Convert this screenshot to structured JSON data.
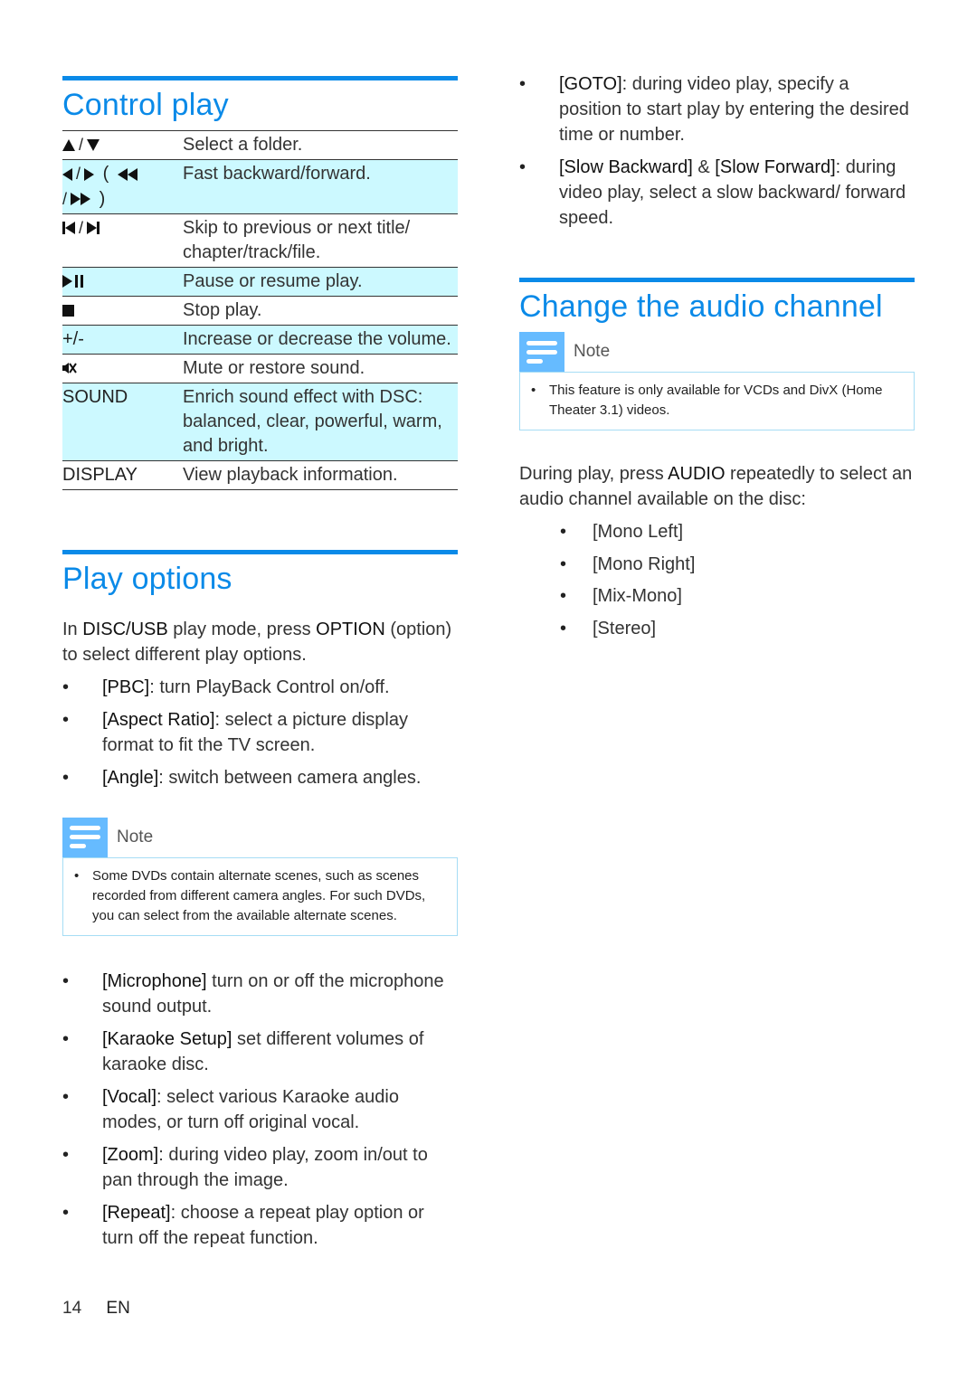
{
  "control_play": {
    "title": "Control play",
    "rows": [
      {
        "key_icons": [
          "up-triangle",
          "down-triangle"
        ],
        "desc": "Select a folder.",
        "highlight": false
      },
      {
        "key_icons": [
          "left-triangle",
          "right-triangle",
          "fast-backward",
          "fast-forward"
        ],
        "desc": "Fast backward/forward.",
        "highlight": true
      },
      {
        "key_icons": [
          "skip-previous",
          "skip-next"
        ],
        "desc": "Skip to previous or next title/ chapter/track/file.",
        "highlight": false
      },
      {
        "key_icons": [
          "play-pause"
        ],
        "desc": "Pause or resume play.",
        "highlight": true
      },
      {
        "key_icons": [
          "stop"
        ],
        "desc": "Stop play.",
        "highlight": false
      },
      {
        "key": "+/-",
        "desc": "Increase or decrease the volume.",
        "highlight": true
      },
      {
        "key_icons": [
          "mute"
        ],
        "desc": "Mute or restore sound.",
        "highlight": false
      },
      {
        "key": "SOUND",
        "desc": "Enrich sound effect with DSC: balanced, clear, powerful, warm, and bright.",
        "highlight": true
      },
      {
        "key": "DISPLAY",
        "desc": "View playback information.",
        "highlight": false
      }
    ]
  },
  "play_options": {
    "title": "Play options",
    "intro": {
      "pre": "In ",
      "kw1": "DISC/USB",
      "mid": " play mode, press ",
      "kw2": "OPTION",
      "post": " (option) to select different play options."
    },
    "items": [
      {
        "kw": "[PBC]",
        "text": ": turn PlayBack Control on/off."
      },
      {
        "kw": "[Aspect Ratio]",
        "text": ": select a picture display format to fit the TV screen."
      },
      {
        "kw": "[Angle]",
        "text": ": switch between camera angles."
      }
    ],
    "note": {
      "label": "Note",
      "items": [
        "Some DVDs contain alternate scenes, such as scenes recorded from different camera angles. For such DVDs, you can select from the available alternate scenes."
      ]
    },
    "items2": [
      {
        "kw": "[Microphone]",
        "text": " turn on or off the microphone sound output."
      },
      {
        "kw": "[Karaoke Setup]",
        "text": " set different volumes of karaoke disc."
      },
      {
        "kw": "[Vocal]",
        "text": ": select various Karaoke audio modes, or turn off original vocal."
      },
      {
        "kw": "[Zoom]",
        "text": ": during video play, zoom in/out to pan through the image."
      },
      {
        "kw": "[Repeat]",
        "text": ": choose a repeat play option or turn off the repeat function."
      }
    ],
    "items3": [
      {
        "kw": "[GOTO]",
        "text": ": during video play, specify a position to start play by entering the desired time or number."
      },
      {
        "kw": "[Slow Backward]",
        "amp": " & ",
        "kw2": "[Slow Forward]",
        "text": ": during video play, select a slow backward/ forward speed."
      }
    ]
  },
  "audio_channel": {
    "title": "Change the audio channel",
    "note": {
      "label": "Note",
      "items": [
        "This feature is only available for VCDs and DivX (Home Theater 3.1) videos."
      ]
    },
    "intro": {
      "pre": "During play, press ",
      "kw": "AUDIO",
      "post": " repeatedly to select an audio channel available on the disc:"
    },
    "options": [
      "[Mono Left]",
      "[Mono Right]",
      "[Mix-Mono]",
      "[Stereo]"
    ]
  },
  "footer": {
    "page": "14",
    "lang": "EN"
  },
  "colors": {
    "accent": "#0a8ae8",
    "row_highlight": "#ccf9ff",
    "note_icon": "#66bbff",
    "note_border": "#a6ddf5"
  }
}
